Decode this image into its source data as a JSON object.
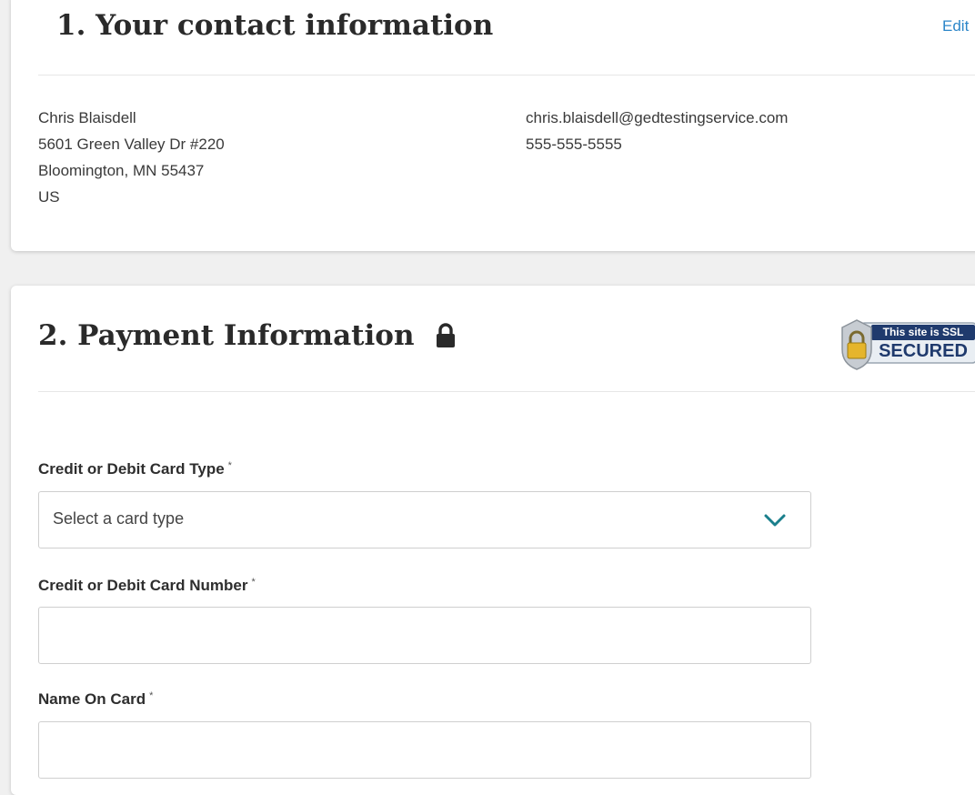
{
  "contact": {
    "title": "1. Your contact information",
    "edit_label": "Edit",
    "address_lines": [
      "Chris Blaisdell",
      "5601 Green Valley Dr #220",
      "Bloomington, MN 55437",
      "US"
    ],
    "email": "chris.blaisdell@gedtestingservice.com",
    "phone": "555-555-5555"
  },
  "payment": {
    "title": "2. Payment Information",
    "ssl_badge": {
      "line1": "This site is SSL",
      "line2": "SECURED"
    },
    "card_type": {
      "label": "Credit or Debit Card Type",
      "required_mark": "*",
      "selected": "Select a card type"
    },
    "card_number": {
      "label": "Credit or Debit Card Number",
      "required_mark": "*",
      "value": ""
    },
    "name_on_card": {
      "label": "Name On Card",
      "required_mark": "*",
      "value": ""
    }
  },
  "colors": {
    "link": "#2c86c9",
    "chevron": "#1a7f8c",
    "badge_navy": "#1f3a6d"
  },
  "icons": {
    "lock": "lock-icon",
    "chevron": "chevron-down-icon",
    "ssl": "padlock-badge-icon"
  }
}
